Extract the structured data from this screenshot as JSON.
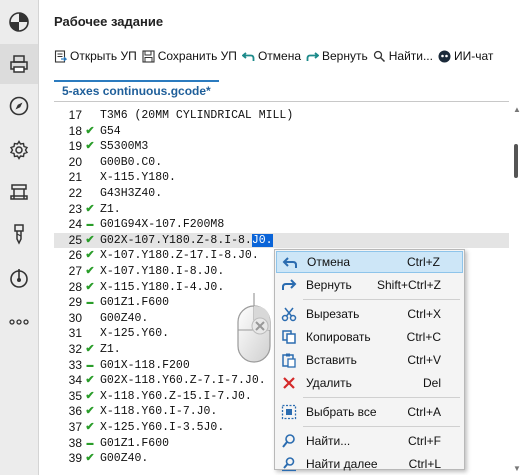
{
  "app": {
    "title": "Рабочее задание"
  },
  "sidebar": {
    "items": [
      {
        "icon": "gauge-icon",
        "active": false
      },
      {
        "icon": "printer-icon",
        "active": true
      },
      {
        "icon": "compass-icon",
        "active": false
      },
      {
        "icon": "gear-icon",
        "active": false
      },
      {
        "icon": "machine-icon",
        "active": false
      },
      {
        "icon": "tool-icon",
        "active": false
      },
      {
        "icon": "spindle-icon",
        "active": false
      },
      {
        "icon": "more-icon",
        "active": false
      }
    ]
  },
  "toolbar": {
    "open_label": "Открыть УП",
    "save_label": "Сохранить УП",
    "undo_label": "Отмена",
    "redo_label": "Вернуть",
    "find_label": "Найти...",
    "ai_label": "ИИ-чат"
  },
  "tab": {
    "label": "5-axes continuous.gcode*"
  },
  "editor": {
    "lines": [
      {
        "n": "17",
        "mark": "",
        "code": "T3M6 (20MM CYLINDRICAL MILL)"
      },
      {
        "n": "18",
        "mark": "check",
        "code": "G54"
      },
      {
        "n": "19",
        "mark": "check",
        "code": "S5300M3"
      },
      {
        "n": "20",
        "mark": "",
        "code": "G00B0.C0."
      },
      {
        "n": "21",
        "mark": "",
        "code": "X-115.Y180."
      },
      {
        "n": "22",
        "mark": "",
        "code": "G43H3Z40."
      },
      {
        "n": "23",
        "mark": "check",
        "code": "Z1."
      },
      {
        "n": "24",
        "mark": "dash",
        "code": "G01G94X-107.F200M8"
      },
      {
        "n": "25",
        "mark": "check",
        "code": "G02X-107.Y180.Z-8.I-8.",
        "sel": "J0."
      },
      {
        "n": "26",
        "mark": "check",
        "code": "X-107.Y180.Z-17.I-8.J0."
      },
      {
        "n": "27",
        "mark": "check",
        "code": "X-107.Y180.I-8.J0."
      },
      {
        "n": "28",
        "mark": "check",
        "code": "X-115.Y180.I-4.J0."
      },
      {
        "n": "29",
        "mark": "dash",
        "code": "G01Z1.F600"
      },
      {
        "n": "30",
        "mark": "",
        "code": "G00Z40."
      },
      {
        "n": "31",
        "mark": "",
        "code": "X-125.Y60."
      },
      {
        "n": "32",
        "mark": "check",
        "code": "Z1."
      },
      {
        "n": "33",
        "mark": "dash",
        "code": "G01X-118.F200"
      },
      {
        "n": "34",
        "mark": "check",
        "code": "G02X-118.Y60.Z-7.I-7.J0."
      },
      {
        "n": "35",
        "mark": "check",
        "code": "X-118.Y60.Z-15.I-7.J0."
      },
      {
        "n": "36",
        "mark": "check",
        "code": "X-118.Y60.I-7.J0."
      },
      {
        "n": "37",
        "mark": "check",
        "code": "X-125.Y60.I-3.5J0."
      },
      {
        "n": "38",
        "mark": "dash",
        "code": "G01Z1.F600"
      },
      {
        "n": "39",
        "mark": "check",
        "code": "G00Z40."
      }
    ]
  },
  "context_menu": {
    "items": [
      {
        "label": "Отмена",
        "shortcut": "Ctrl+Z",
        "icon": "undo-icon",
        "active": true
      },
      {
        "label": "Вернуть",
        "shortcut": "Shift+Ctrl+Z",
        "icon": "redo-icon"
      },
      {
        "sep": true
      },
      {
        "label": "Вырезать",
        "shortcut": "Ctrl+X",
        "icon": "cut-icon"
      },
      {
        "label": "Копировать",
        "shortcut": "Ctrl+C",
        "icon": "copy-icon"
      },
      {
        "label": "Вставить",
        "shortcut": "Ctrl+V",
        "icon": "paste-icon"
      },
      {
        "label": "Удалить",
        "shortcut": "Del",
        "icon": "delete-icon"
      },
      {
        "sep": true
      },
      {
        "label": "Выбрать все",
        "shortcut": "Ctrl+A",
        "icon": "select-all-icon"
      },
      {
        "sep": true
      },
      {
        "label": "Найти...",
        "shortcut": "Ctrl+F",
        "icon": "find-icon"
      },
      {
        "label": "Найти далее",
        "shortcut": "Ctrl+L",
        "icon": "find-next-icon"
      }
    ]
  },
  "colors": {
    "accent": "#2b7bbf",
    "selection": "#0a64d8",
    "check": "#2a9d2a",
    "menu_hover": "#cde6f7"
  }
}
